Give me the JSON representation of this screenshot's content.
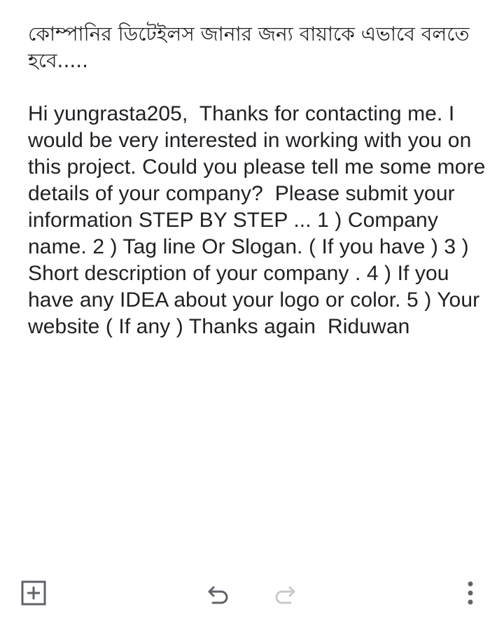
{
  "note": {
    "title": "কোম্পানির ডিটেইলস জানার জন্য বায়াকে এভাবে বলতে হবে.....",
    "body": "Hi yungrasta205,  Thanks for contacting me. I would be very interested in working with you on this project. Could you please tell me some more details of your company?  Please submit your information STEP BY STEP ... 1 ) Company name. 2 ) Tag line Or Slogan. ( If you have ) 3 ) Short description of your company . 4 ) If you have any IDEA about your logo or color. 5 ) Your website ( If any ) Thanks again  Riduwan"
  },
  "toolbar": {
    "add_icon": "add-box-icon",
    "undo_icon": "undo-icon",
    "redo_icon": "redo-icon",
    "more_icon": "more-vert-icon",
    "icon_color": "#5f6368",
    "disabled_icon_color": "#c7c9cc"
  }
}
